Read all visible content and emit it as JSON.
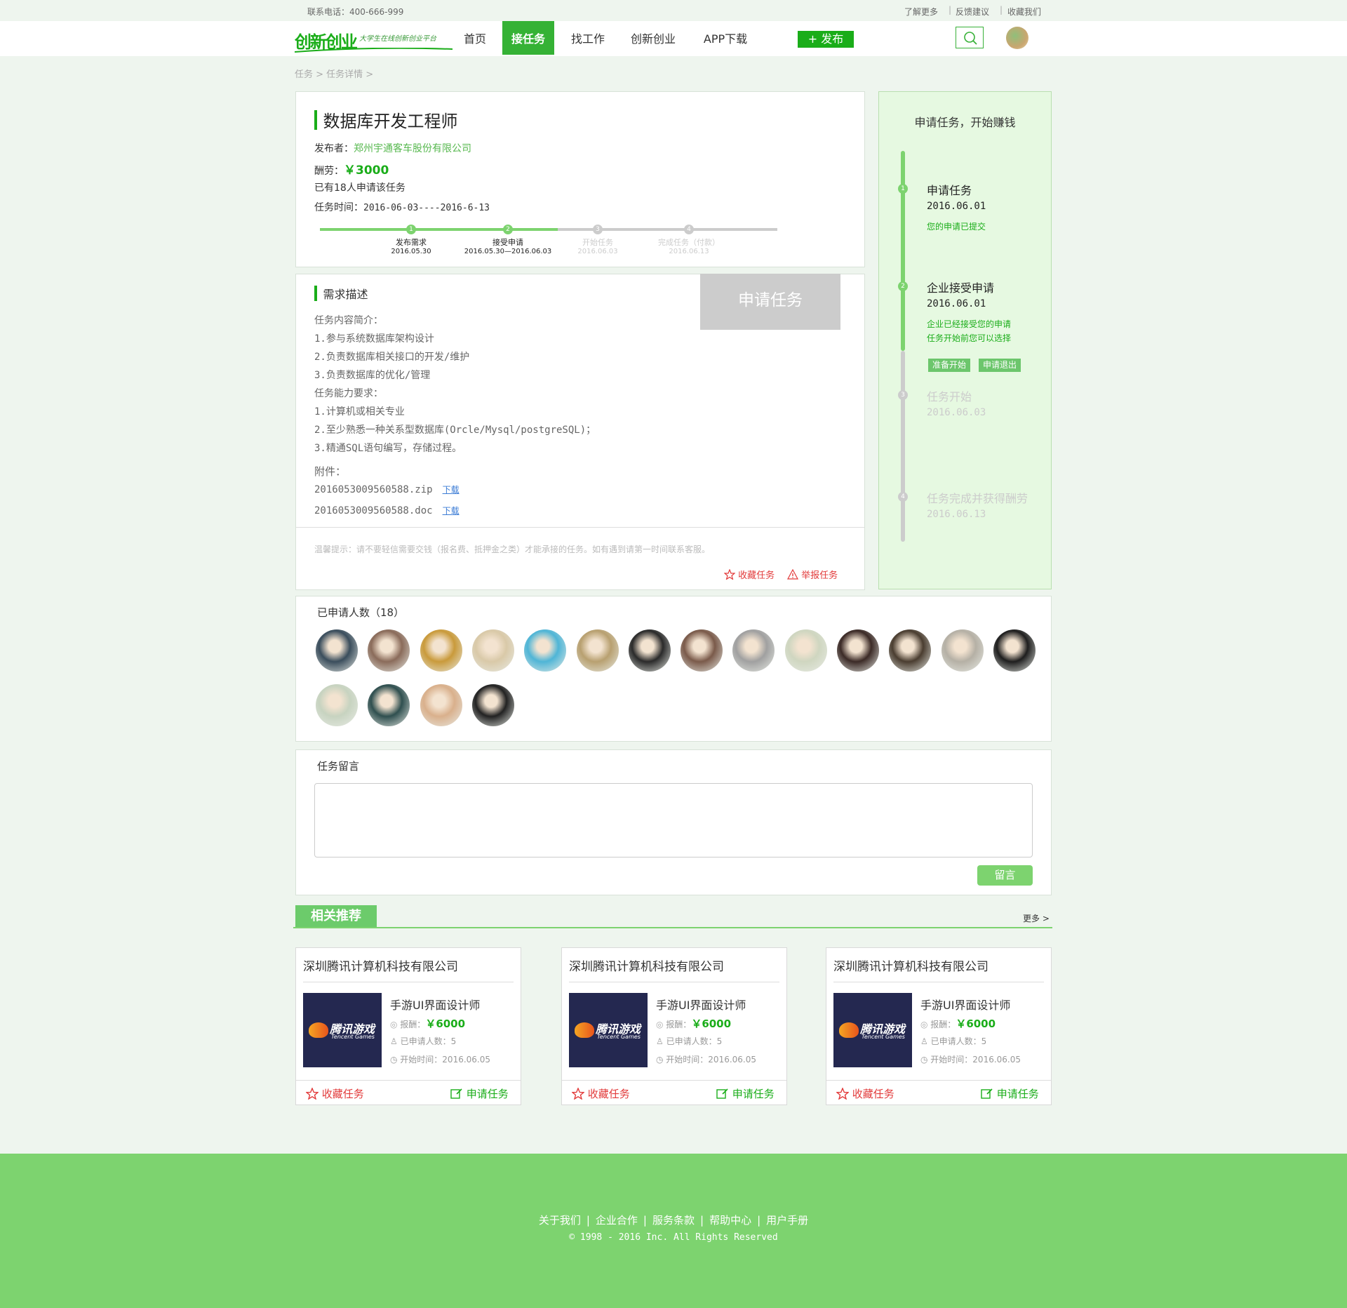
{
  "topbar": {
    "phone": "联系电话：400-666-999",
    "links": [
      "了解更多",
      "反馈建议",
      "收藏我们"
    ]
  },
  "logo": {
    "text": "创新创业",
    "slogan": "大学生在线创新创业平台"
  },
  "nav": {
    "items": [
      "首页",
      "接任务",
      "找工作",
      "创新创业",
      "APP下载"
    ],
    "active": "接任务",
    "publish": "+ 发布"
  },
  "breadcrumb": "任务 > 任务详情 >",
  "task": {
    "title": "数据库开发工程师",
    "publisher_label": "发布者：",
    "publisher": "郑州宇通客车股份有限公司",
    "pay_label": "酬劳：",
    "pay": "￥3000",
    "applicants_text": "已有18人申请该任务",
    "time_label": "任务时间：",
    "time": "2016-06-03----2016-6-13",
    "progress": {
      "fraction": 0.52,
      "steps": [
        {
          "num": "1",
          "label": "发布需求",
          "date": "2016.05.30",
          "active": true
        },
        {
          "num": "2",
          "label": "接受申请",
          "date": "2016.05.30—2016.06.03",
          "active": true
        },
        {
          "num": "3",
          "label": "开始任务",
          "date": "2016.06.03",
          "active": false
        },
        {
          "num": "4",
          "label": "完成任务（付款）",
          "date": "2016.06.13",
          "active": false
        }
      ]
    }
  },
  "description": {
    "heading": "需求描述",
    "apply_button": "申请任务",
    "lines": [
      "任务内容简介：",
      "1.参与系统数据库架构设计",
      "2.负责数据库相关接口的开发/维护",
      "3.负责数据库的优化/管理",
      "任务能力要求：",
      "1.计算机或相关专业",
      "2.至少熟悉一种关系型数据库(Orcle/Mysql/postgreSQL)；",
      "3.精通SQL语句编写，存储过程。"
    ],
    "attachments_label": "附件：",
    "attachments": [
      {
        "name": "2016053009560588.zip",
        "action": "下载"
      },
      {
        "name": "2016053009560588.doc",
        "action": "下载"
      }
    ],
    "tip": "温馨提示：请不要轻信需要交钱（报名费、抵押金之类）才能承接的任务。如有遇到请第一时间联系客服。",
    "collect": "收藏任务",
    "report": "举报任务"
  },
  "sidebar": {
    "title": "申请任务，开始赚钱",
    "steps": [
      {
        "num": "1",
        "title": "申请任务",
        "date": "2016.06.01",
        "notes": [
          "您的申请已提交"
        ],
        "active": true
      },
      {
        "num": "2",
        "title": "企业接受申请",
        "date": "2016.06.01",
        "notes": [
          "企业已经接受您的申请",
          "任务开始前您可以选择"
        ],
        "buttons": [
          "准备开始",
          "申请退出"
        ],
        "active": true
      },
      {
        "num": "3",
        "title": "任务开始",
        "date": "2016.06.03",
        "notes": [],
        "active": false
      },
      {
        "num": "4",
        "title": "任务完成并获得酬劳",
        "date": "2016.06.13",
        "notes": [],
        "active": false
      }
    ]
  },
  "applicants": {
    "heading": "已申请人数（18）",
    "count": 18,
    "avatar_colors": [
      "#3a4d5c",
      "#8a6b5a",
      "#c99a3b",
      "#d9c9a8",
      "#4fb5d6",
      "#b8a070",
      "#2a2a2a",
      "#7a5a4a",
      "#a0a0a0",
      "#cfd6c0",
      "#3b2a26",
      "#4a3d30",
      "#b5b0a5",
      "#1e1e1e",
      "#c7d3c0",
      "#2f4f4f",
      "#d9b08c",
      "#222222"
    ]
  },
  "comments": {
    "heading": "任务留言",
    "placeholder": "",
    "submit": "留言"
  },
  "related": {
    "heading": "相关推荐",
    "more": "更多 >",
    "cards": [
      {
        "company": "深圳腾讯计算机科技有限公司",
        "logo_text": "腾讯游戏",
        "logo_sub": "Tencent Games",
        "job": "手游UI界面设计师",
        "pay_label": "报酬：",
        "pay": "￥6000",
        "applied": "已申请人数：5",
        "start": "开始时间：2016.06.05",
        "collect": "收藏任务",
        "apply": "申请任务"
      },
      {
        "company": "深圳腾讯计算机科技有限公司",
        "logo_text": "腾讯游戏",
        "logo_sub": "Tencent Games",
        "job": "手游UI界面设计师",
        "pay_label": "报酬：",
        "pay": "￥6000",
        "applied": "已申请人数：5",
        "start": "开始时间：2016.06.05",
        "collect": "收藏任务",
        "apply": "申请任务"
      },
      {
        "company": "深圳腾讯计算机科技有限公司",
        "logo_text": "腾讯游戏",
        "logo_sub": "Tencent Games",
        "job": "手游UI界面设计师",
        "pay_label": "报酬：",
        "pay": "￥6000",
        "applied": "已申请人数：5",
        "start": "开始时间：2016.06.05",
        "collect": "收藏任务",
        "apply": "申请任务"
      }
    ]
  },
  "footer": {
    "links": [
      "关于我们",
      "企业合作",
      "服务条款",
      "帮助中心",
      "用户手册"
    ],
    "copyright": "© 1998 - 2016  Inc. All Rights Reserved"
  },
  "colors": {
    "brand": "#1aad19",
    "light_green": "#7dd36f",
    "panel": "#e6f9e1",
    "red": "#e23a3a"
  }
}
